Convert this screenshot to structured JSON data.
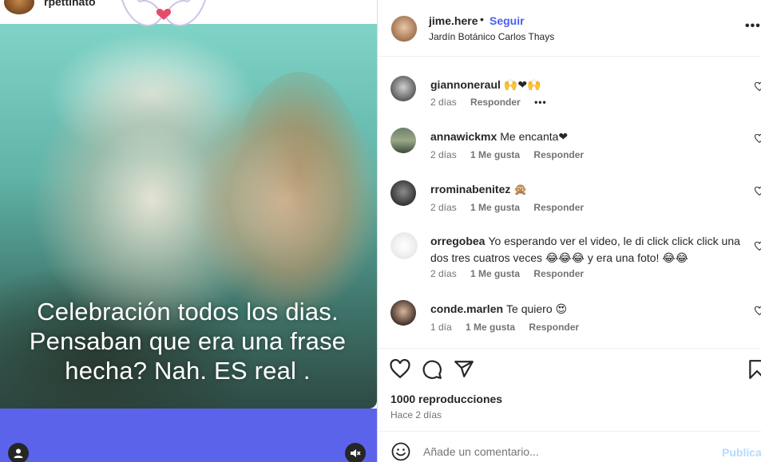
{
  "reel": {
    "username": "rpettinato",
    "caption": "Celebración todos los dias. Pensaban que era una frase hecha? Nah. ES real ."
  },
  "header": {
    "username": "jime.here",
    "separator": "•",
    "follow_label": "Seguir",
    "location": "Jardín Botánico Carlos Thays",
    "more": "•••"
  },
  "comments": [
    {
      "user": "giannoneraul",
      "text": "🙌❤🙌",
      "age": "2 días",
      "likes": "",
      "reply": "Responder",
      "more": "•••"
    },
    {
      "user": "annawickmx",
      "text": "Me encanta❤",
      "age": "2 días",
      "likes": "1 Me gusta",
      "reply": "Responder"
    },
    {
      "user": "rrominabenitez",
      "text": "🙊",
      "age": "2 días",
      "likes": "1 Me gusta",
      "reply": "Responder"
    },
    {
      "user": "orregobea",
      "text": "Yo esperando ver el video, le di click click click una dos tres cuatros veces 😂😂😂 y era una foto! 😂😂",
      "age": "2 días",
      "likes": "1 Me gusta",
      "reply": "Responder"
    },
    {
      "user": "conde.marlen",
      "text": "Te quiero 😍",
      "age": "1 día",
      "likes": "1 Me gusta",
      "reply": "Responder"
    }
  ],
  "stats": {
    "views": "1000 reproducciones",
    "posted": "Hace 2 días"
  },
  "composer": {
    "placeholder": "Añade un comentario...",
    "publish_label": "Publicar"
  },
  "colors": {
    "follow": "#4a5ef0",
    "media_bottom": "#5a63ea",
    "publish_disabled": "#b3dbff"
  }
}
